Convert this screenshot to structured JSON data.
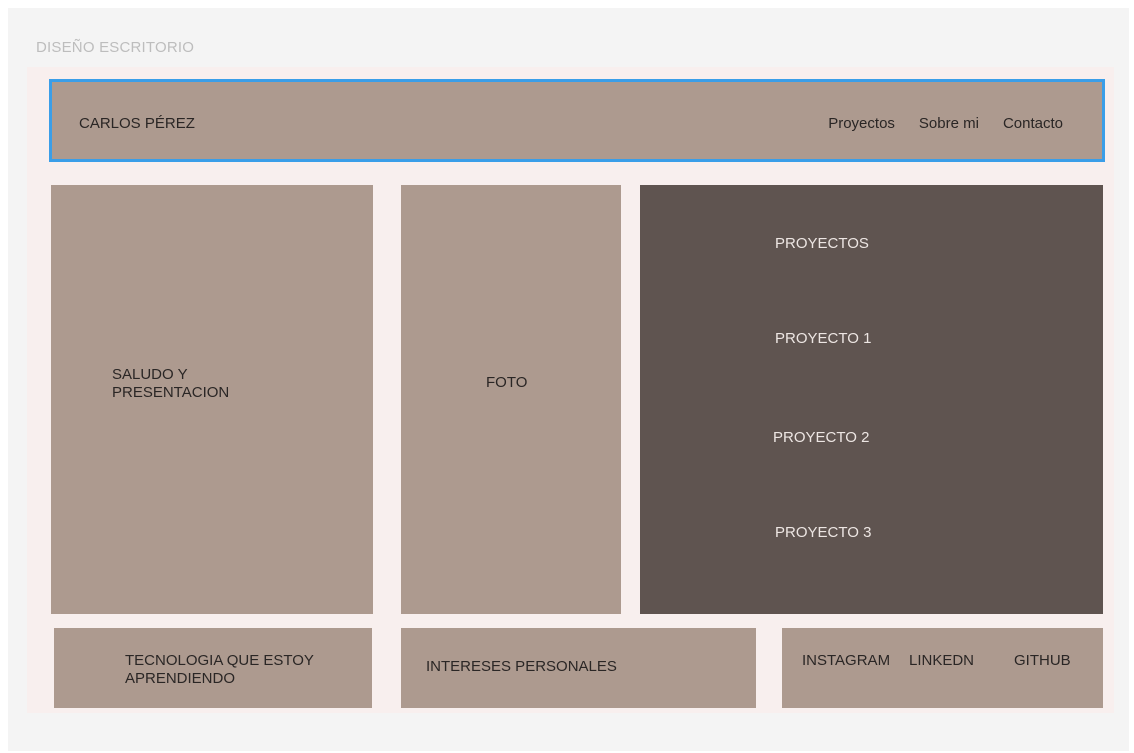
{
  "frame": {
    "label": "DISEÑO ESCRITORIO"
  },
  "header": {
    "brand": "CARLOS PÉREZ",
    "nav": [
      "Proyectos",
      "Sobre mi",
      "Contacto"
    ]
  },
  "sections": {
    "saludo": "SALUDO Y PRESENTACION",
    "foto": "FOTO",
    "proyectos": {
      "title": "PROYECTOS",
      "items": [
        "PROYECTO 1",
        "PROYECTO 2",
        "PROYECTO 3"
      ]
    },
    "tecnologia": "TECNOLOGIA QUE ESTOY APRENDIENDO",
    "intereses": "INTERESES PERSONALES",
    "redes": [
      "INSTAGRAM",
      "LINKEDN",
      "GITHUB"
    ]
  },
  "colors": {
    "block": "#ad9a8f",
    "dark_block": "#5f5450",
    "selection": "#3a9ee8",
    "canvas": "#f8efee"
  }
}
